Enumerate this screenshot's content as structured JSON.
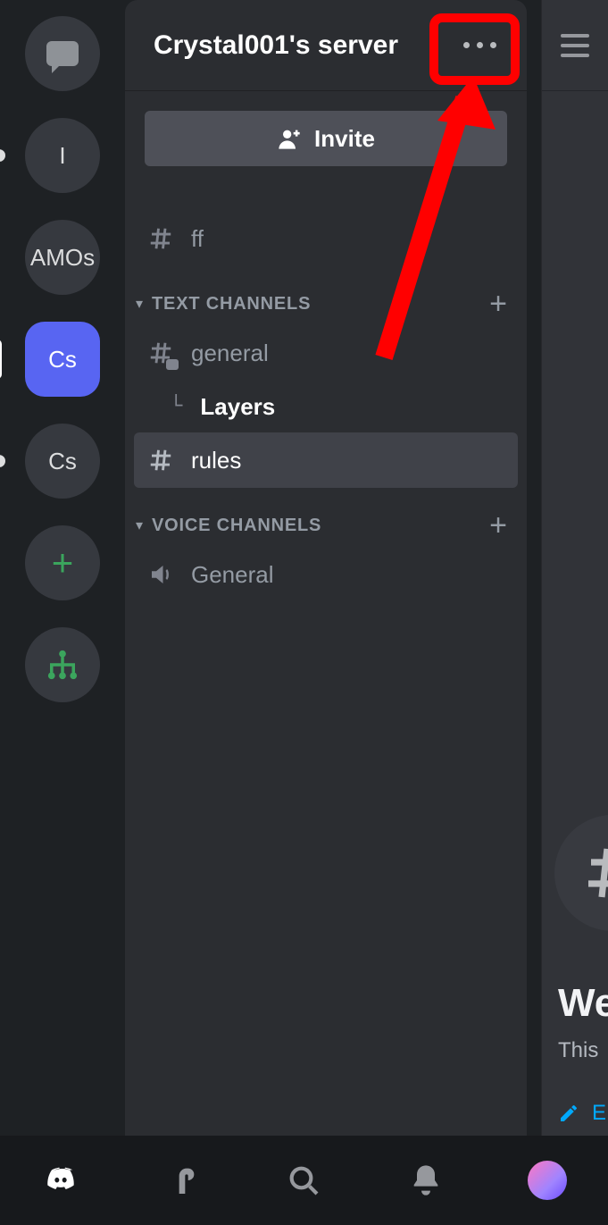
{
  "rail": {
    "items": [
      {
        "kind": "dm"
      },
      {
        "kind": "server",
        "label": "I",
        "pip": "dot"
      },
      {
        "kind": "server",
        "label": "AMOs"
      },
      {
        "kind": "server",
        "label": "Cs",
        "active": true,
        "pip": "tall"
      },
      {
        "kind": "server",
        "label": "Cs",
        "pip": "dot"
      },
      {
        "kind": "add"
      },
      {
        "kind": "hub"
      }
    ]
  },
  "panel": {
    "title": "Crystal001's server",
    "invite_label": "Invite",
    "uncategorized": [
      {
        "name": "ff",
        "type": "text"
      }
    ],
    "categories": [
      {
        "label": "TEXT CHANNELS",
        "channels": [
          {
            "name": "general",
            "type": "text-badge",
            "threads": [
              {
                "name": "Layers"
              }
            ]
          },
          {
            "name": "rules",
            "type": "text",
            "selected": true
          }
        ]
      },
      {
        "label": "VOICE CHANNELS",
        "channels": [
          {
            "name": "General",
            "type": "voice"
          }
        ]
      }
    ]
  },
  "content": {
    "welcome_heading": "We",
    "welcome_sub": "This",
    "edit_label": "E"
  }
}
